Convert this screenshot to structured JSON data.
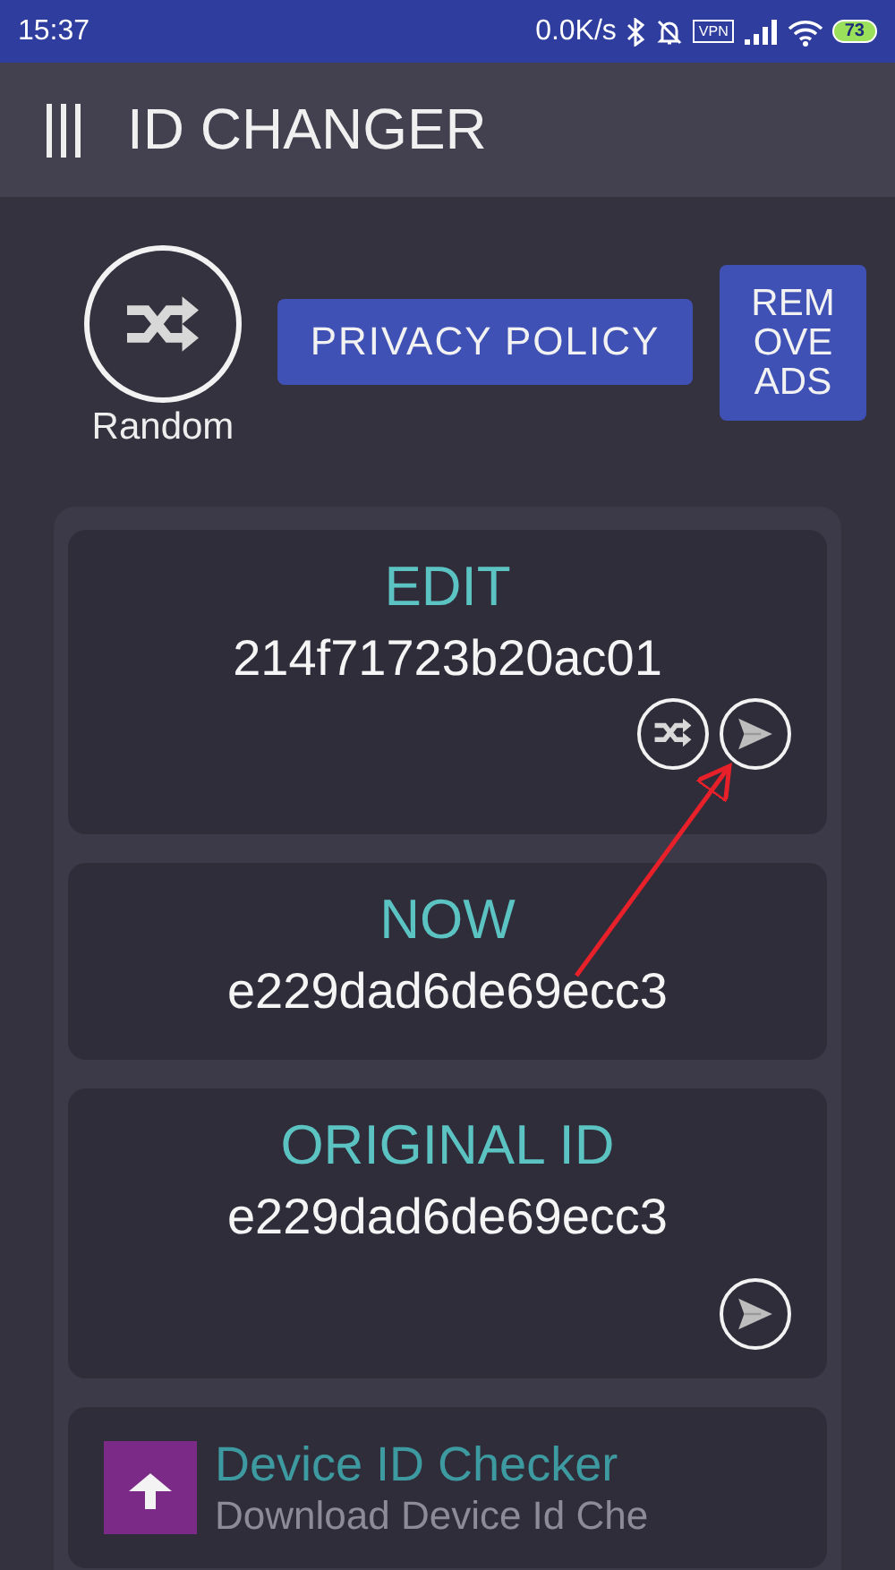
{
  "status_bar": {
    "time": "15:37",
    "net_speed": "0.0K/s",
    "vpn": "VPN",
    "battery": "73"
  },
  "app_bar": {
    "title": "ID CHANGER"
  },
  "actions": {
    "random_label": "Random",
    "privacy_button": "PRIVACY POLICY",
    "remove_ads_button": "REMOVE ADS"
  },
  "cards": [
    {
      "label": "EDIT",
      "value": "214f71723b20ac01",
      "buttons": [
        {
          "kind": "shuffle"
        },
        {
          "kind": "send"
        }
      ]
    },
    {
      "label": "NOW",
      "value": "e229dad6de69ecc3"
    },
    {
      "label": "ORIGINAL ID",
      "value": "e229dad6de69ecc3",
      "buttons": [
        {
          "kind": "send"
        }
      ]
    }
  ],
  "ad": {
    "title": "Device ID Checker",
    "subtitle": "Download Device Id Che"
  }
}
